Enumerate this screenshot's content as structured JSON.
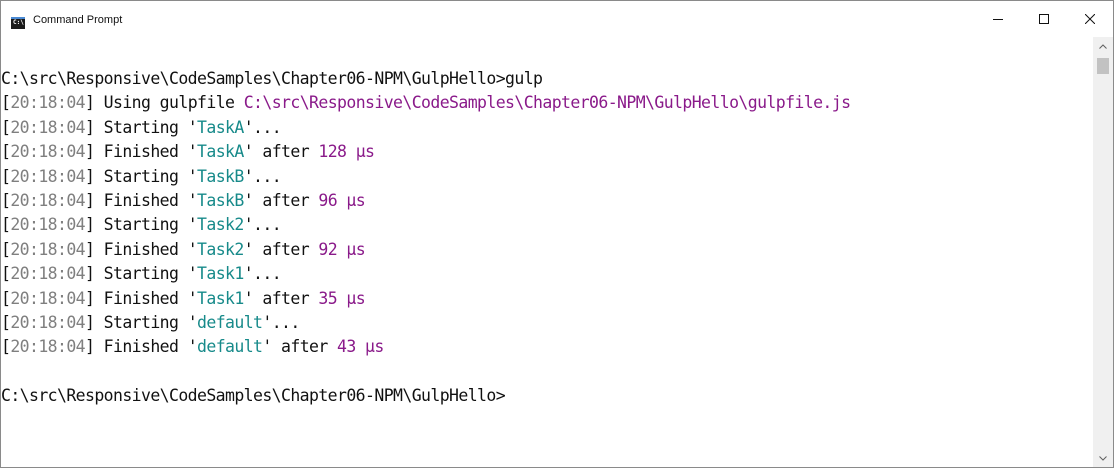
{
  "window": {
    "title": "Command Prompt",
    "icon": "cmd-icon"
  },
  "controls": {
    "minimize": "minimize-icon",
    "maximize": "maximize-icon",
    "close": "close-icon"
  },
  "colors": {
    "timestamp": "#7f7f7f",
    "path": "#8a1a8a",
    "task": "#178a8a",
    "number": "#8a1a8a",
    "text": "#111111"
  },
  "console": {
    "lines": [
      [
        {
          "t": "C:\\src\\Responsive\\CodeSamples\\Chapter06-NPM\\GulpHello>gulp",
          "c": "plain"
        }
      ],
      [
        {
          "t": "[",
          "c": "plain"
        },
        {
          "t": "20:18:04",
          "c": "ts"
        },
        {
          "t": "] Using gulpfile ",
          "c": "plain"
        },
        {
          "t": "C:\\src\\Responsive\\CodeSamples\\Chapter06-NPM\\GulpHello\\gulpfile.js",
          "c": "path"
        }
      ],
      [
        {
          "t": "[",
          "c": "plain"
        },
        {
          "t": "20:18:04",
          "c": "ts"
        },
        {
          "t": "] Starting '",
          "c": "plain"
        },
        {
          "t": "TaskA",
          "c": "task"
        },
        {
          "t": "'...",
          "c": "plain"
        }
      ],
      [
        {
          "t": "[",
          "c": "plain"
        },
        {
          "t": "20:18:04",
          "c": "ts"
        },
        {
          "t": "] Finished '",
          "c": "plain"
        },
        {
          "t": "TaskA",
          "c": "task"
        },
        {
          "t": "' after ",
          "c": "plain"
        },
        {
          "t": "128 μs",
          "c": "num"
        }
      ],
      [
        {
          "t": "[",
          "c": "plain"
        },
        {
          "t": "20:18:04",
          "c": "ts"
        },
        {
          "t": "] Starting '",
          "c": "plain"
        },
        {
          "t": "TaskB",
          "c": "task"
        },
        {
          "t": "'...",
          "c": "plain"
        }
      ],
      [
        {
          "t": "[",
          "c": "plain"
        },
        {
          "t": "20:18:04",
          "c": "ts"
        },
        {
          "t": "] Finished '",
          "c": "plain"
        },
        {
          "t": "TaskB",
          "c": "task"
        },
        {
          "t": "' after ",
          "c": "plain"
        },
        {
          "t": "96 μs",
          "c": "num"
        }
      ],
      [
        {
          "t": "[",
          "c": "plain"
        },
        {
          "t": "20:18:04",
          "c": "ts"
        },
        {
          "t": "] Starting '",
          "c": "plain"
        },
        {
          "t": "Task2",
          "c": "task"
        },
        {
          "t": "'...",
          "c": "plain"
        }
      ],
      [
        {
          "t": "[",
          "c": "plain"
        },
        {
          "t": "20:18:04",
          "c": "ts"
        },
        {
          "t": "] Finished '",
          "c": "plain"
        },
        {
          "t": "Task2",
          "c": "task"
        },
        {
          "t": "' after ",
          "c": "plain"
        },
        {
          "t": "92 μs",
          "c": "num"
        }
      ],
      [
        {
          "t": "[",
          "c": "plain"
        },
        {
          "t": "20:18:04",
          "c": "ts"
        },
        {
          "t": "] Starting '",
          "c": "plain"
        },
        {
          "t": "Task1",
          "c": "task"
        },
        {
          "t": "'...",
          "c": "plain"
        }
      ],
      [
        {
          "t": "[",
          "c": "plain"
        },
        {
          "t": "20:18:04",
          "c": "ts"
        },
        {
          "t": "] Finished '",
          "c": "plain"
        },
        {
          "t": "Task1",
          "c": "task"
        },
        {
          "t": "' after ",
          "c": "plain"
        },
        {
          "t": "35 μs",
          "c": "num"
        }
      ],
      [
        {
          "t": "[",
          "c": "plain"
        },
        {
          "t": "20:18:04",
          "c": "ts"
        },
        {
          "t": "] Starting '",
          "c": "plain"
        },
        {
          "t": "default",
          "c": "task"
        },
        {
          "t": "'...",
          "c": "plain"
        }
      ],
      [
        {
          "t": "[",
          "c": "plain"
        },
        {
          "t": "20:18:04",
          "c": "ts"
        },
        {
          "t": "] Finished '",
          "c": "plain"
        },
        {
          "t": "default",
          "c": "task"
        },
        {
          "t": "' after ",
          "c": "plain"
        },
        {
          "t": "43 μs",
          "c": "num"
        }
      ],
      [
        {
          "t": "",
          "c": "plain"
        }
      ],
      [
        {
          "t": "C:\\src\\Responsive\\CodeSamples\\Chapter06-NPM\\GulpHello>",
          "c": "plain"
        }
      ]
    ]
  },
  "scrollbar": {
    "up": "scroll-up-arrow-icon",
    "down": "scroll-down-arrow-icon"
  }
}
